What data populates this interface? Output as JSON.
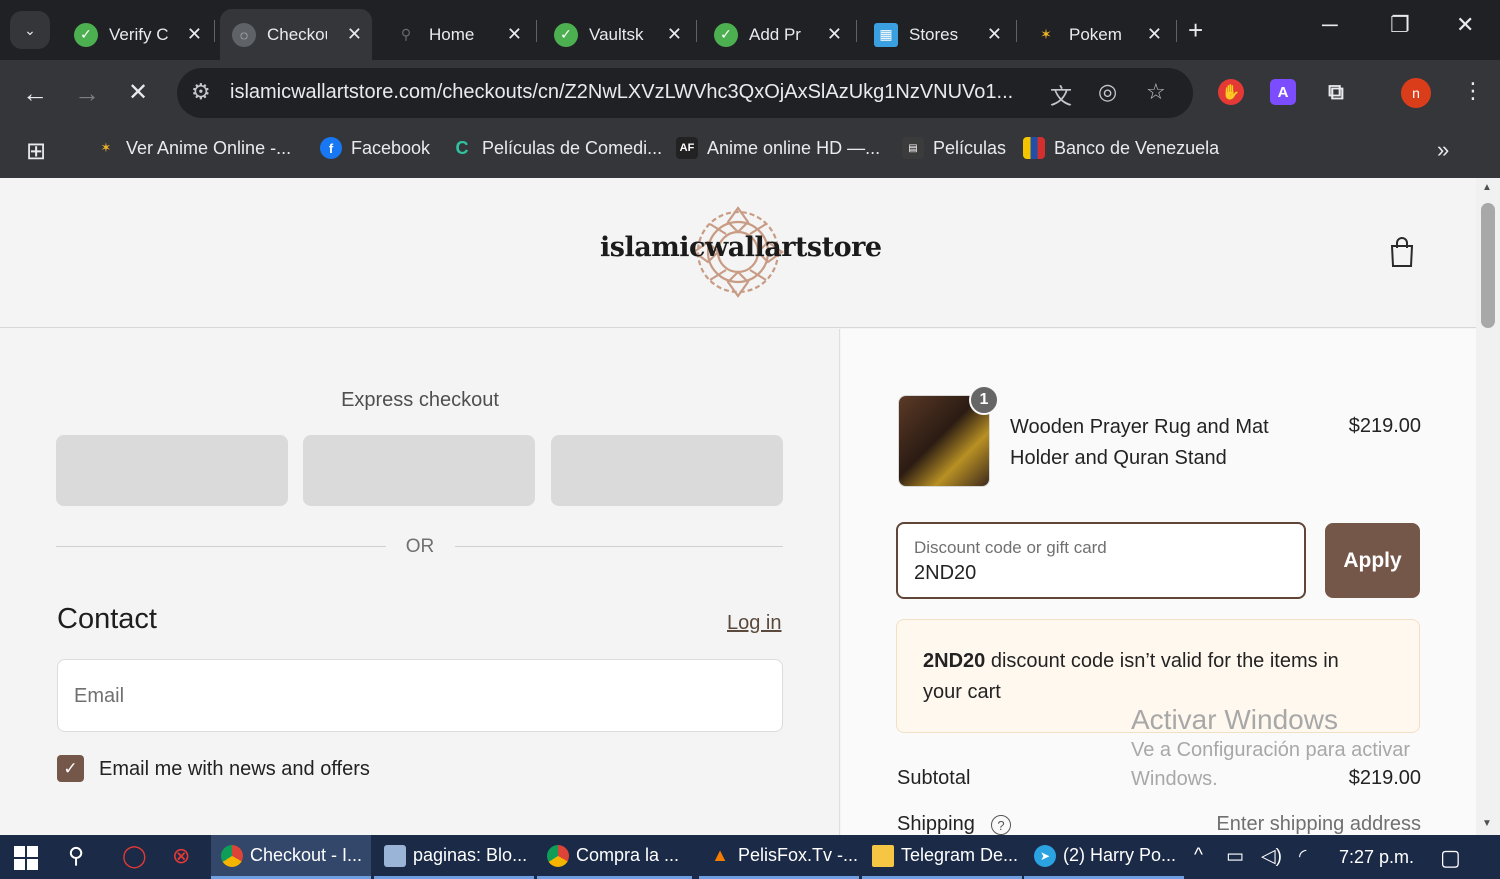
{
  "browser": {
    "tabs": [
      {
        "title": "Verify C",
        "active": false
      },
      {
        "title": "Checkout",
        "active": true
      },
      {
        "title": "Home",
        "active": false
      },
      {
        "title": "Vaultsk",
        "active": false
      },
      {
        "title": "Add Pr",
        "active": false
      },
      {
        "title": "Stores",
        "active": false
      },
      {
        "title": "Pokem",
        "active": false
      }
    ],
    "new_tab": "+",
    "url": "islamicwallartstore.com/checkouts/cn/Z2NwLXVzLWVhc3QxOjAxSlAzUkg1NzVNUVo1...",
    "profile_initial": "n",
    "bookmarks": [
      "Ver Anime Online -...",
      "Facebook",
      "Películas de Comedi...",
      "Anime online HD —...",
      "Películas",
      "Banco de Venezuela"
    ]
  },
  "store": {
    "logo_text": "islamicwallartstore"
  },
  "checkout": {
    "express_title": "Express checkout",
    "or_label": "OR",
    "contact_title": "Contact",
    "login_label": "Log in",
    "email_placeholder": "Email",
    "newsletter_label": "Email me with news and offers",
    "newsletter_checked": true
  },
  "summary": {
    "product": {
      "quantity": "1",
      "name": "Wooden Prayer Rug and Mat Holder and Quran Stand",
      "price": "$219.00"
    },
    "discount_placeholder": "Discount code or gift card",
    "discount_value": "2ND20",
    "apply_label": "Apply",
    "error_code": "2ND20",
    "error_message": " discount code isn’t valid for the items in your cart",
    "subtotal_label": "Subtotal",
    "subtotal_value": "$219.00",
    "shipping_label": "Shipping",
    "shipping_value": "Enter shipping address"
  },
  "watermark": {
    "title": "Activar Windows",
    "line1": "Ve a Configuración para activar",
    "line2": "Windows."
  },
  "taskbar": {
    "apps": [
      "Checkout - I...",
      "paginas: Blo...",
      "Compra la ...",
      "PelisFox.Tv -...",
      "Telegram De...",
      "(2) Harry Po..."
    ],
    "time": "7:27 p.m."
  },
  "colors": {
    "brand_brown": "#75574a",
    "error_bg": "#fff8ef",
    "chrome_dark": "#202124",
    "chrome_toolbar": "#35363a"
  }
}
